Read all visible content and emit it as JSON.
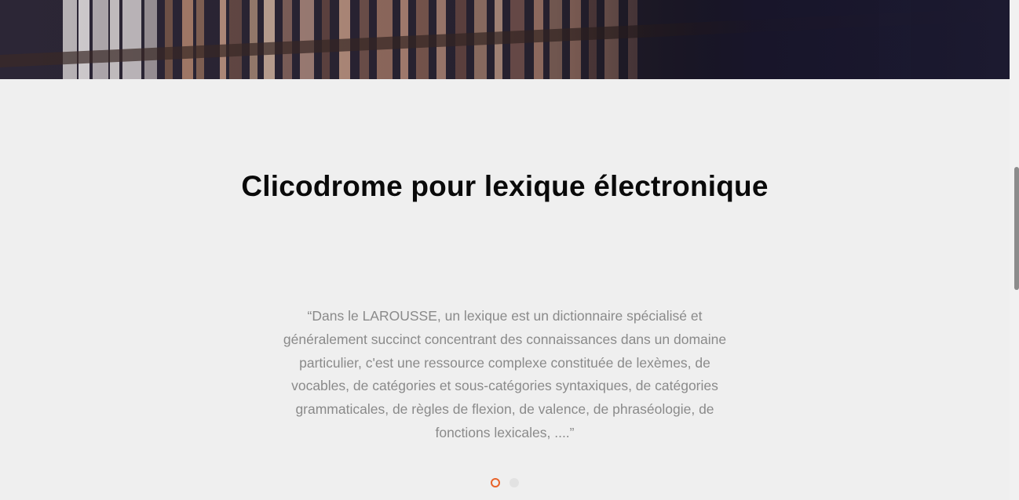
{
  "hero": {
    "image": "bookshelf-library-photo",
    "colors": {
      "overlay": "#1a1830",
      "base": "#2a2538"
    }
  },
  "section": {
    "title": "Clicodrome pour lexique électronique"
  },
  "testimonial": {
    "quote": "“Dans le LAROUSSE, un lexique est un dictionnaire spécialisé et généralement succinct concentrant des connaissances dans un domaine particulier, c'est une ressource complexe constituée de lexèmes, de vocables, de catégories et sous-catégories syntaxiques, de catégories grammaticales, de règles de flexion, de valence, de phraséologie, de fonctions lexicales, ....”"
  },
  "carousel": {
    "slide_count": 2,
    "active_index": 0,
    "colors": {
      "active": "#e8632a",
      "inactive": "#e2e2e2"
    }
  },
  "colors": {
    "background": "#efefef",
    "title": "#0a0a0a",
    "body_text": "#8a8a8a"
  }
}
